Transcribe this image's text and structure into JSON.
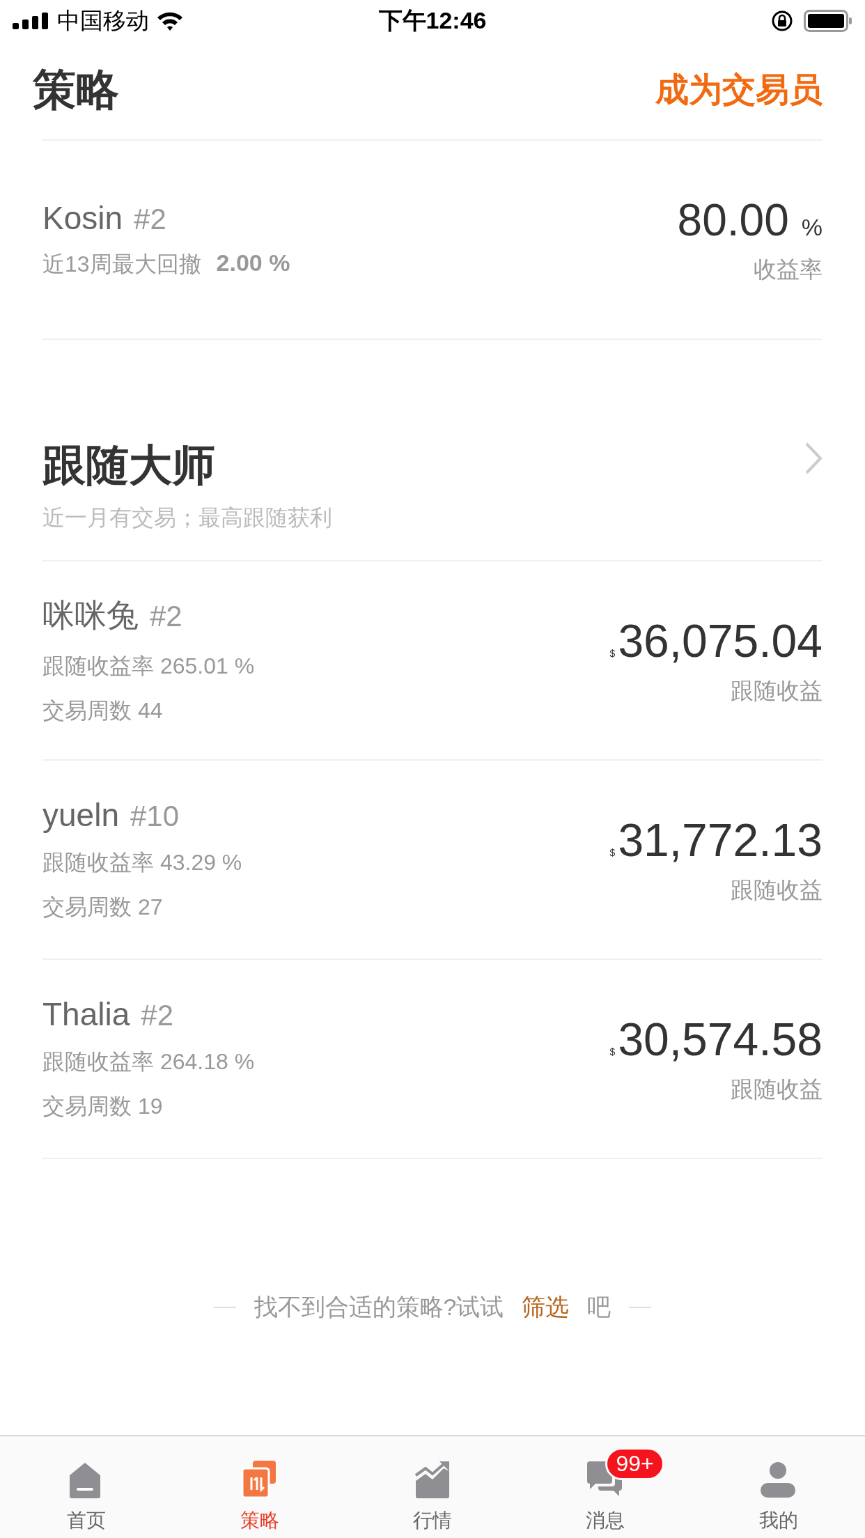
{
  "status_bar": {
    "carrier": "中国移动",
    "time": "下午12:46"
  },
  "header": {
    "title": "策略",
    "action": "成为交易员"
  },
  "top_strategy": {
    "name": "Kosin",
    "rank": "#2",
    "metric_label": "近13周最大回撤",
    "metric_value": "2.00 %",
    "value": "80.00",
    "unit": "%",
    "value_label": "收益率"
  },
  "masters_section": {
    "title": "跟随大师",
    "subtitle": "近一月有交易；最高跟随获利",
    "rows": [
      {
        "name": "咪咪兔",
        "rank": "#2",
        "lines": [
          "跟随收益率 265.01 %",
          "交易周数 44"
        ],
        "currency": "$",
        "amount": "36,075.04",
        "label": "跟随收益"
      },
      {
        "name": "yueln",
        "rank": "#10",
        "lines": [
          "跟随收益率 43.29 %",
          "交易周数 27"
        ],
        "currency": "$",
        "amount": "31,772.13",
        "label": "跟随收益"
      },
      {
        "name": "Thalia",
        "rank": "#2",
        "lines": [
          "跟随收益率 264.18 %",
          "交易周数 19"
        ],
        "currency": "$",
        "amount": "30,574.58",
        "label": "跟随收益"
      }
    ]
  },
  "footer_hint": {
    "before": "找不到合适的策略?试试",
    "link": "筛选",
    "after": "吧"
  },
  "tabs": [
    {
      "kind": "home",
      "label": "首页",
      "selected": false
    },
    {
      "kind": "strategy",
      "label": "策略",
      "selected": true
    },
    {
      "kind": "chart",
      "label": "行情",
      "selected": false
    },
    {
      "kind": "message",
      "label": "消息",
      "selected": false,
      "badge": "99+"
    },
    {
      "kind": "user",
      "label": "我的",
      "selected": false
    }
  ]
}
